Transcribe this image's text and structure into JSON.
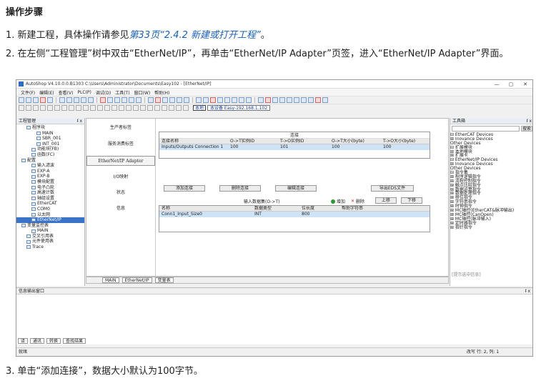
{
  "doc": {
    "heading": "操作步骤",
    "step1_prefix": "1. 新建工程，具体操作请参见",
    "step1_link": "第33页“2.4.2 新建或打开工程”",
    "step1_suffix": "。",
    "step2": "2. 在左侧“工程管理”树中双击“EtherNet/IP”，再单击“EtherNet/IP Adapter”页签，进入“EtherNet/IP Adapter”界面。",
    "step3": "3. 单击“添加连接”，数据大小默认为100字节。"
  },
  "app": {
    "title": "AutoShop V4.10.0.0.B1303  C:\\Users\\Administrator\\Documents\\Easy102 - [EtherNet/IP]",
    "win_min": "—",
    "win_max": "▢",
    "win_close": "✕",
    "menu": [
      "文件(F)",
      "编辑(E)",
      "查看(V)",
      "PLC(P)",
      "调试(D)",
      "工具(T)",
      "窗口(W)",
      "帮助(H)"
    ],
    "toolbar_local": "本地",
    "toolbar_addr": "本设备 Easy-192.168.1.102",
    "left_pane": {
      "title": "工程管理",
      "pin": "ᵮ x",
      "items": [
        {
          "label": "程序块",
          "indent": 2
        },
        {
          "label": "MAIN",
          "indent": 4
        },
        {
          "label": "SBR_001",
          "indent": 4
        },
        {
          "label": "INT_001",
          "indent": 4
        },
        {
          "label": "功能块(FB)",
          "indent": 3
        },
        {
          "label": "函数(FC)",
          "indent": 3
        },
        {
          "label": "配置",
          "indent": 1
        },
        {
          "label": "输入滤波",
          "indent": 3
        },
        {
          "label": "EXP-A",
          "indent": 3
        },
        {
          "label": "EXP-B",
          "indent": 3
        },
        {
          "label": "模块配置",
          "indent": 3
        },
        {
          "label": "电子凸轮",
          "indent": 3
        },
        {
          "label": "高速计数",
          "indent": 3
        },
        {
          "label": "轴组设置",
          "indent": 3
        },
        {
          "label": "EtherCAT",
          "indent": 3
        },
        {
          "label": "COM0",
          "indent": 3
        },
        {
          "label": "以太网",
          "indent": 3
        },
        {
          "label": "EtherNet/IP",
          "indent": 3,
          "selected": true
        },
        {
          "label": "变量监控表",
          "indent": 1
        },
        {
          "label": "MAIN",
          "indent": 3
        },
        {
          "label": "交叉引用表",
          "indent": 2
        },
        {
          "label": "元件使用表",
          "indent": 2
        },
        {
          "label": "Trace",
          "indent": 2
        }
      ]
    },
    "nav": {
      "items": [
        "生产者标签",
        "服务消费标签",
        "EtherNet/IP Adapter",
        "I/O映射",
        "状态",
        "信息"
      ],
      "active_index": 2
    },
    "conn_grid": {
      "title": "连接",
      "headers": [
        "连接名称",
        "O->T实例ID",
        "T->O实例ID",
        "O->T大小(byte)",
        "T->O大小(byte)"
      ],
      "row": [
        "Inputs/Outputs Connection 1",
        "100",
        "101",
        "100",
        "100"
      ]
    },
    "buttons": {
      "add_conn": "添加连接",
      "del_conn": "删除连接",
      "edit_conn": "编辑连接",
      "export_eds": "导出EDS文件",
      "add": "增加",
      "delete": "删除",
      "up": "上移",
      "down": "下移"
    },
    "input_data_label": "输入数据集(O->T)",
    "data_grid": {
      "headers": [
        "名称",
        "数据类型",
        "位长度",
        "帮助字符串"
      ],
      "row": [
        "Conn1_Input_Size0",
        "INT",
        "800",
        ""
      ]
    },
    "right_pane": {
      "title": "工具箱",
      "pin": "ᵮ x",
      "search_btn": "搜索",
      "items": [
        "⊟ EtherCAT Devices",
        "   ⊞ Inovance Devices",
        "      Other Devices",
        "⊟ 扩展模块",
        "   ⊞ 本地模块",
        "   ⊞ 扩展卡",
        "⊟ EtherNet/IP Devices",
        "   ⊞ Inovance Devices",
        "      Other Devices",
        "⊟ 指令集",
        "   ⊞ 程序逻辑指令",
        "   ⊞ 流程控制指令",
        "   ⊞ 触点比较指令",
        "   ⊞ 数据运算指令",
        "   ⊞ 数据处理指令",
        "   ⊞ 移位指令",
        "   ⊞ 字符串指令",
        "   ⊞ 时钟指令",
        "   ⊞ MC轴控(EtherCAT&脉冲输出)",
        "   ⊞ MC轴控(CanOpen)",
        "   ⊞ MC轴控(脉冲输入)",
        "   ⊞ 定时器指令",
        "   ⊞ 指针指令"
      ],
      "hint": "[提示选中信息]"
    },
    "tabs": [
      "MAIN",
      "EtherNet/IP",
      "变量表"
    ],
    "output": {
      "title": "信息输出窗口",
      "pin": "ᵮ x",
      "tabs": [
        "译",
        "通讯",
        "转换",
        "查找结果"
      ]
    },
    "status": {
      "left": "就绪",
      "right": "改写  行: 2, 列: 1"
    }
  }
}
